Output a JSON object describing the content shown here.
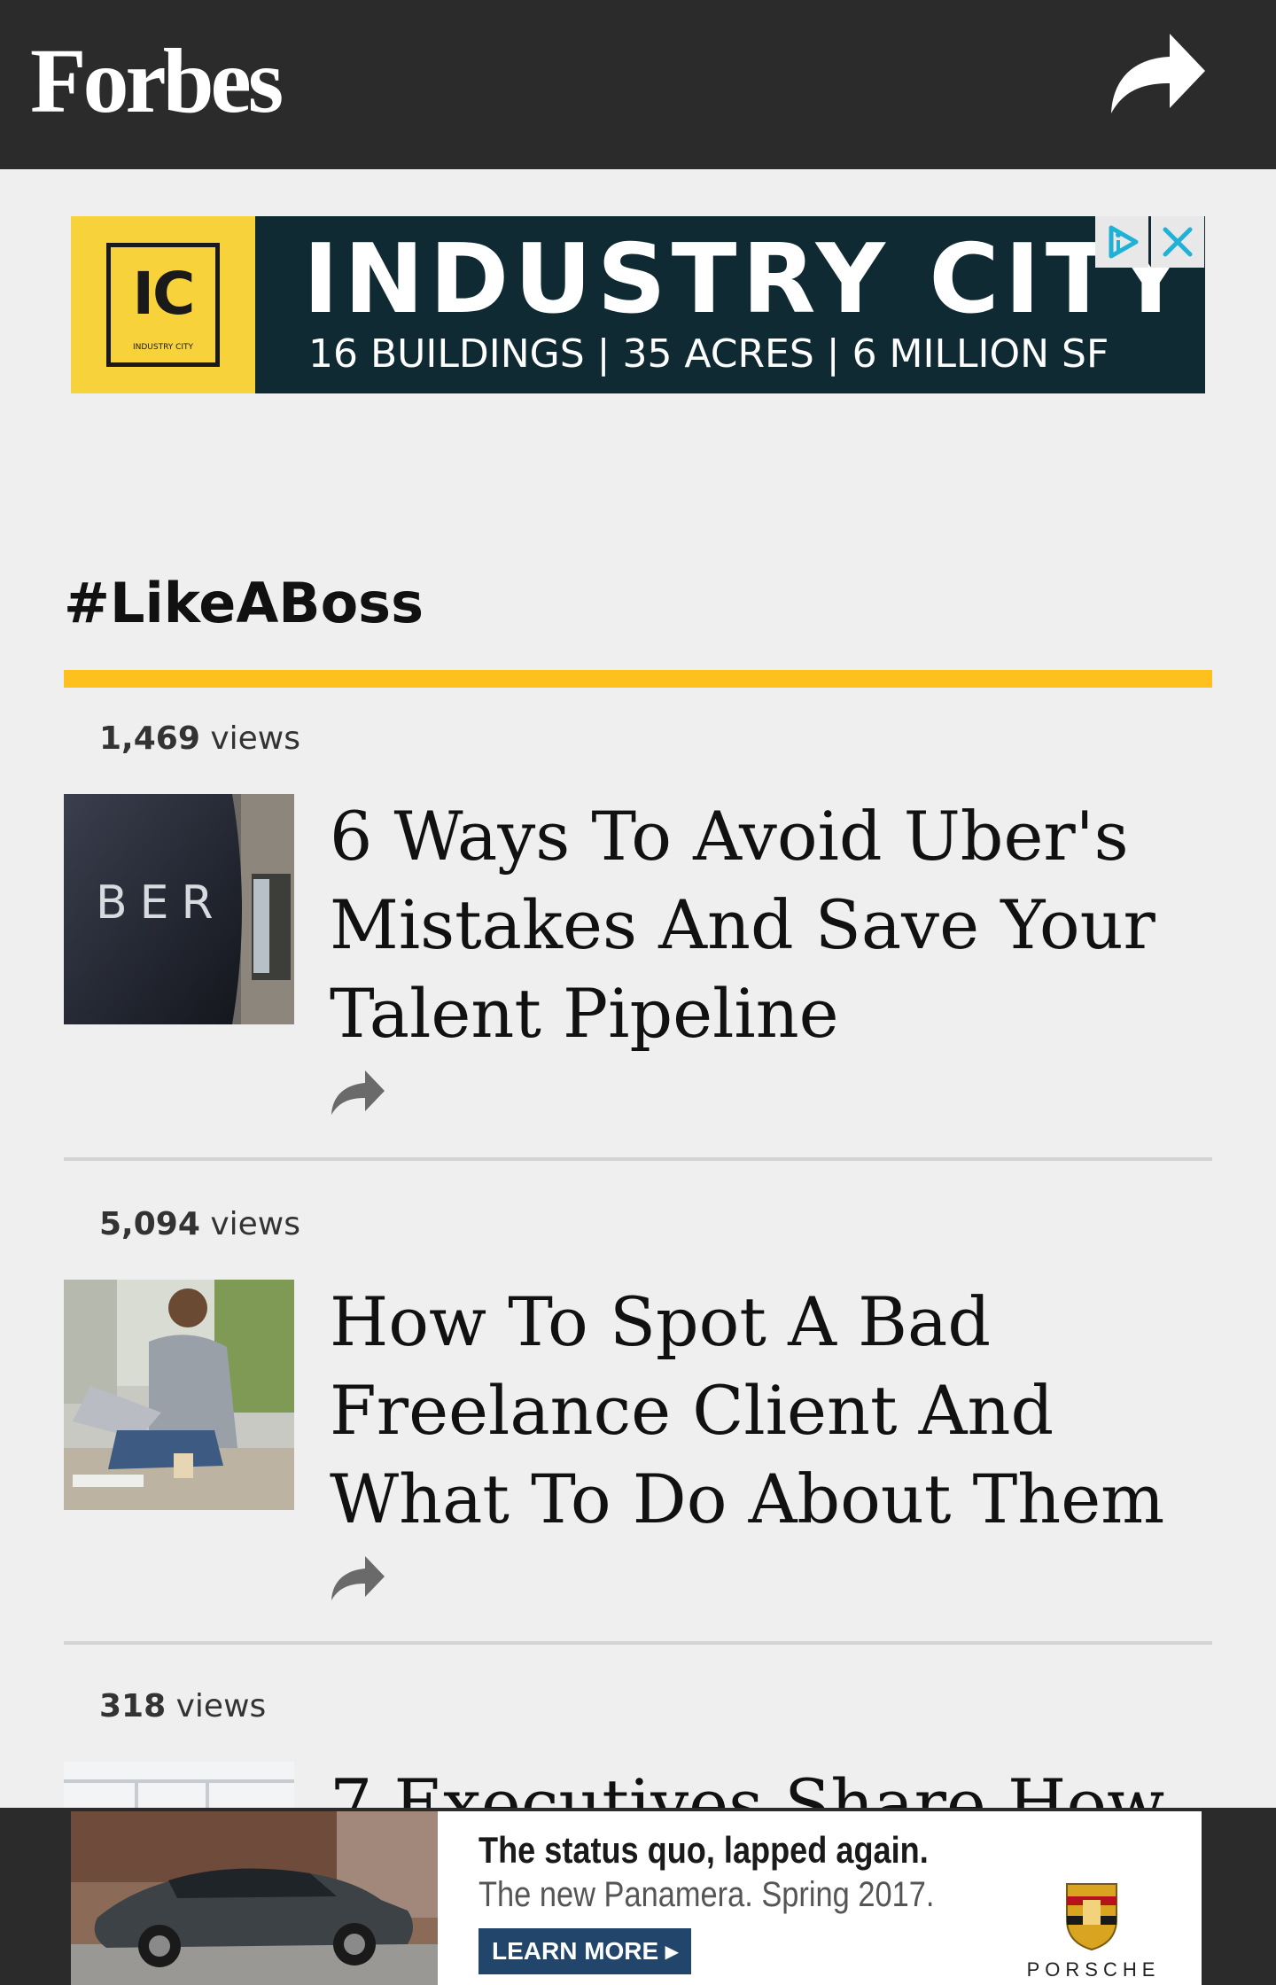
{
  "header": {
    "logo": "Forbes",
    "share_icon": "share-arrow-icon"
  },
  "top_ad": {
    "logo_letters": "IC",
    "logo_small": "INDUSTRY CITY",
    "title": "INDUSTRY CITY",
    "subtitle": "16 BUILDINGS  |  35 ACRES  |  6 MILLION SF",
    "adchoices_icon": "adchoices-icon",
    "close_icon": "close-icon",
    "colors": {
      "background": "#0f2a33",
      "logo_bg": "#f7d23a"
    }
  },
  "section": {
    "title": "#LikeABoss",
    "accent": "#fec01c"
  },
  "articles": [
    {
      "views_count": "1,469",
      "views_label": "views",
      "headline": "6 Ways To Avoid Uber's Mistakes And Save Your Talent Pipeline",
      "thumb_text": "BER"
    },
    {
      "views_count": "5,094",
      "views_label": "views",
      "headline": "How To Spot A Bad Freelance Client And What To Do About Them"
    },
    {
      "views_count": "318",
      "views_label": "views",
      "headline": "7 Executives Share How"
    }
  ],
  "bottom_ad": {
    "line1": "The status quo, lapped again.",
    "line2": "The new Panamera. Spring 2017.",
    "button": "LEARN MORE ▸",
    "brand": "PORSCHE"
  }
}
